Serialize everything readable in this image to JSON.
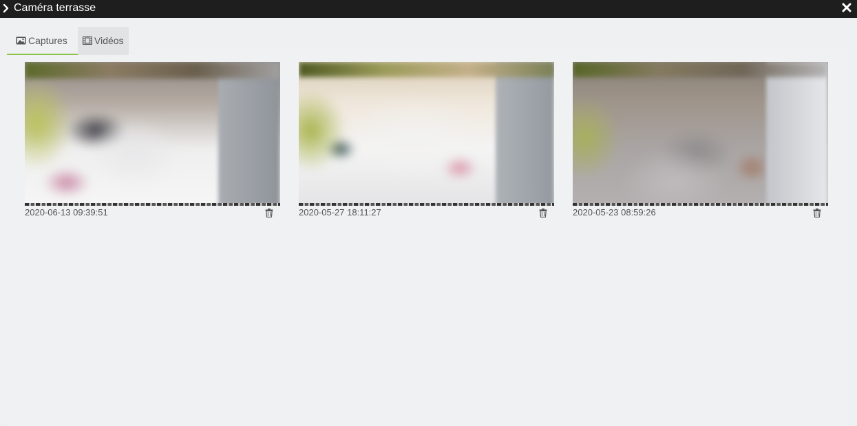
{
  "window": {
    "title": "Caméra terrasse"
  },
  "tabs": [
    {
      "label": "Captures",
      "icon": "image-icon",
      "active": true
    },
    {
      "label": "Vidéos",
      "icon": "film-icon",
      "active": false
    }
  ],
  "captures": [
    {
      "timestamp": "2020-06-13 09:39:51"
    },
    {
      "timestamp": "2020-05-27 18:11:27"
    },
    {
      "timestamp": "2020-05-23 08:59:26"
    }
  ],
  "colors": {
    "titlebar": "#1e1e1e",
    "active_tab_underline": "#8bc34a",
    "background": "#eff0f1"
  }
}
